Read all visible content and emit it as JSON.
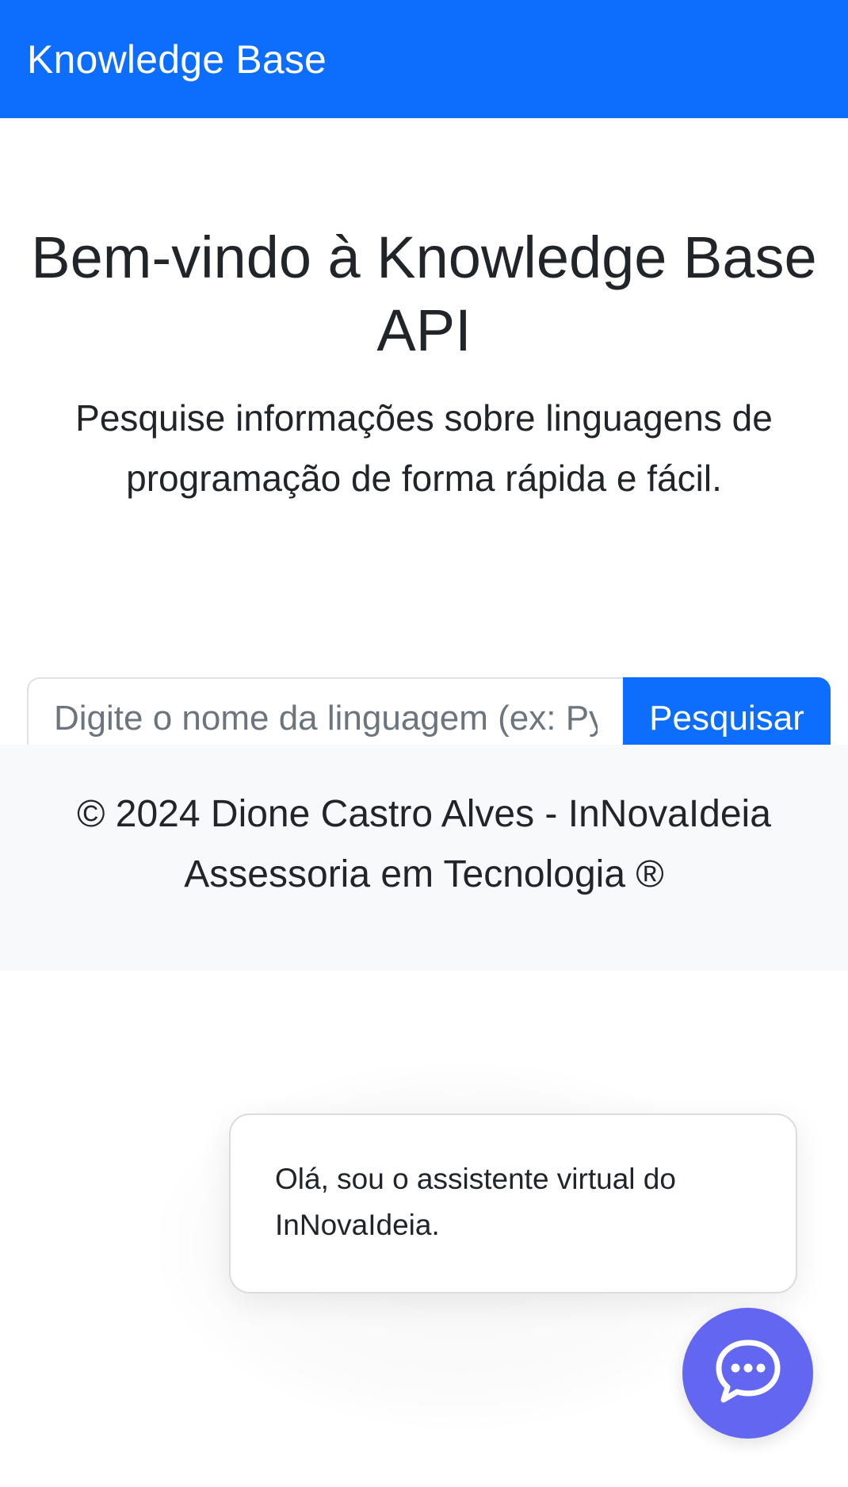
{
  "navbar": {
    "brand": "Knowledge Base"
  },
  "hero": {
    "title": "Bem-vindo à Knowledge Base API",
    "subtitle": "Pesquise informações sobre linguagens de programação de forma rápida e fácil."
  },
  "search": {
    "placeholder": "Digite o nome da linguagem (ex: Python)",
    "value": "",
    "button_label": "Pesquisar"
  },
  "footer": {
    "text": "© 2024 Dione Castro Alves - InNovaIdeia Assessoria em Tecnologia ®"
  },
  "chat": {
    "greeting": "Olá, sou o assistente virtual do InNovaIdeia.",
    "launcher_icon": "chat-bubble-icon"
  },
  "colors": {
    "primary": "#0d6efd",
    "footer_bg": "#f8f9fa",
    "chat_accent": "#6366f1",
    "text": "#212529"
  }
}
